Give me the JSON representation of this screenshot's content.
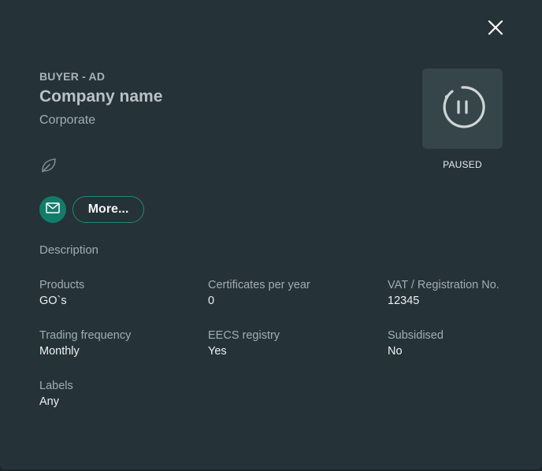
{
  "header": {
    "kicker": "BUYER - AD",
    "title": "Company name",
    "subtitle": "Corporate"
  },
  "status": {
    "label": "PAUSED",
    "icon": "pause-circle-icon"
  },
  "actions": {
    "mail_icon": "mail-icon",
    "more_label": "More..."
  },
  "description_label": "Description",
  "fields": {
    "products": {
      "label": "Products",
      "value": "GO`s"
    },
    "certificates": {
      "label": "Certificates per year",
      "value": "0"
    },
    "vat": {
      "label": "VAT / Registration No.",
      "value": "12345"
    },
    "trading_frequency": {
      "label": "Trading frequency",
      "value": "Monthly"
    },
    "eecs_registry": {
      "label": "EECS registry",
      "value": "Yes"
    },
    "subsidised": {
      "label": "Subsidised",
      "value": "No"
    },
    "labels": {
      "label": "Labels",
      "value": "Any"
    }
  },
  "colors": {
    "background": "#253238",
    "accent": "#127c6a",
    "status_tile": "#364549"
  }
}
